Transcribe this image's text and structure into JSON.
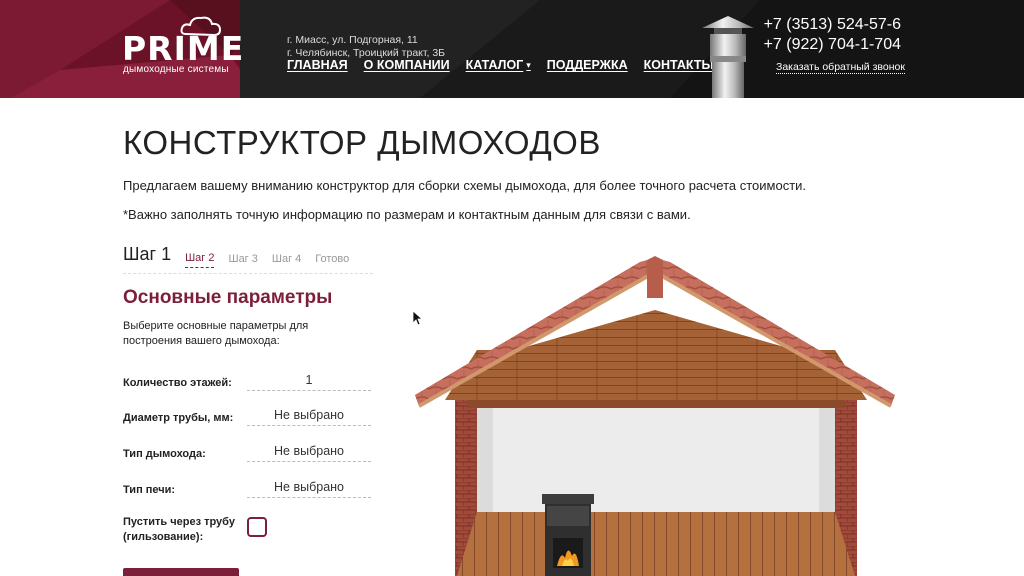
{
  "header": {
    "logo_text": "PRIME",
    "logo_sub": "дымоходные системы",
    "address1": "г. Миасс, ул. Подгорная, 11",
    "address2": "г. Челябинск, Троицкий тракт, 3Б",
    "nav": [
      "ГЛАВНАЯ",
      "О КОМПАНИИ",
      "КАТАЛОГ",
      "ПОДДЕРЖКА",
      "КОНТАКТЫ"
    ],
    "phone1": "+7 (3513) 524-57-6",
    "phone2": "+7 (922) 704-1-704",
    "callback": "Заказать обратный звонок"
  },
  "main": {
    "title": "КОНСТРУКТОР ДЫМОХОДОВ",
    "intro": "Предлагаем вашему вниманию конструктор для сборки схемы дымохода, для более точного расчета стоимости.",
    "note": "*Важно заполнять точную информацию по размерам и контактным данным для связи с вами."
  },
  "steps": [
    "Шаг 1",
    "Шаг 2",
    "Шаг 3",
    "Шаг 4",
    "Готово"
  ],
  "form": {
    "section_title": "Основные параметры",
    "section_desc": "Выберите основные параметры для построения вашего дымохода:",
    "fields": [
      {
        "label": "Количество этажей:",
        "value": "1"
      },
      {
        "label": "Диаметр трубы, мм:",
        "value": "Не выбрано"
      },
      {
        "label": "Тип дымохода:",
        "value": "Не выбрано"
      },
      {
        "label": "Тип печи:",
        "value": "Не выбрано"
      }
    ],
    "sleeve_label": "Пустить через трубу (гильзование):",
    "sleeve_checked": false
  },
  "colors": {
    "accent": "#7b1f3a",
    "header_bg": "#1b1b1b"
  },
  "icons": {
    "nav_dropdown": "chevron-down-icon",
    "cursor": "mouse-cursor-icon"
  }
}
